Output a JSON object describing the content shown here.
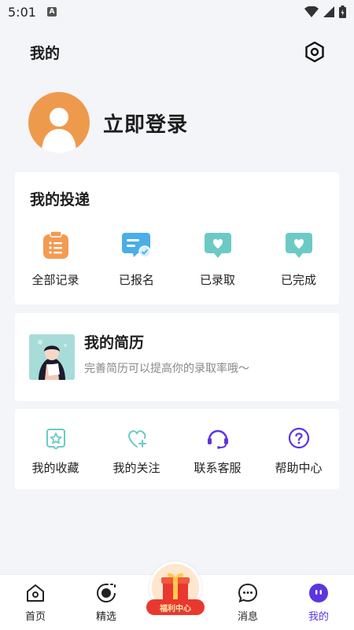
{
  "status": {
    "time": "5:01",
    "badge": "A"
  },
  "header": {
    "title": "我的"
  },
  "profile": {
    "login": "立即登录"
  },
  "delivery": {
    "title": "我的投递",
    "items": [
      {
        "label": "全部记录",
        "icon": "clipboard-list-icon",
        "color": "#f39b52"
      },
      {
        "label": "已报名",
        "icon": "chat-check-icon",
        "color": "#4aaee8"
      },
      {
        "label": "已录取",
        "icon": "chat-heart-icon",
        "color": "#6ccac4"
      },
      {
        "label": "已完成",
        "icon": "chat-heart-icon",
        "color": "#6ccac4"
      }
    ]
  },
  "resume": {
    "title": "我的简历",
    "subtitle": "完善简历可以提高你的录取率哦～"
  },
  "services": {
    "items": [
      {
        "label": "我的收藏",
        "icon": "star-pocket-icon"
      },
      {
        "label": "我的关注",
        "icon": "heart-plus-icon"
      },
      {
        "label": "联系客服",
        "icon": "headset-icon"
      },
      {
        "label": "帮助中心",
        "icon": "question-circle-icon"
      }
    ]
  },
  "tabbar": {
    "tabs": [
      {
        "label": "首页",
        "icon": "home-icon"
      },
      {
        "label": "精选",
        "icon": "eye-icon"
      },
      {
        "label": "消息",
        "icon": "chat-bubble-icon"
      },
      {
        "label": "我的",
        "icon": "smiley-icon",
        "active": true
      }
    ],
    "welfare": "福利中心"
  },
  "colors": {
    "accent": "#5b35e0",
    "teal": "#6ccac4",
    "orange": "#ee9a4d"
  }
}
